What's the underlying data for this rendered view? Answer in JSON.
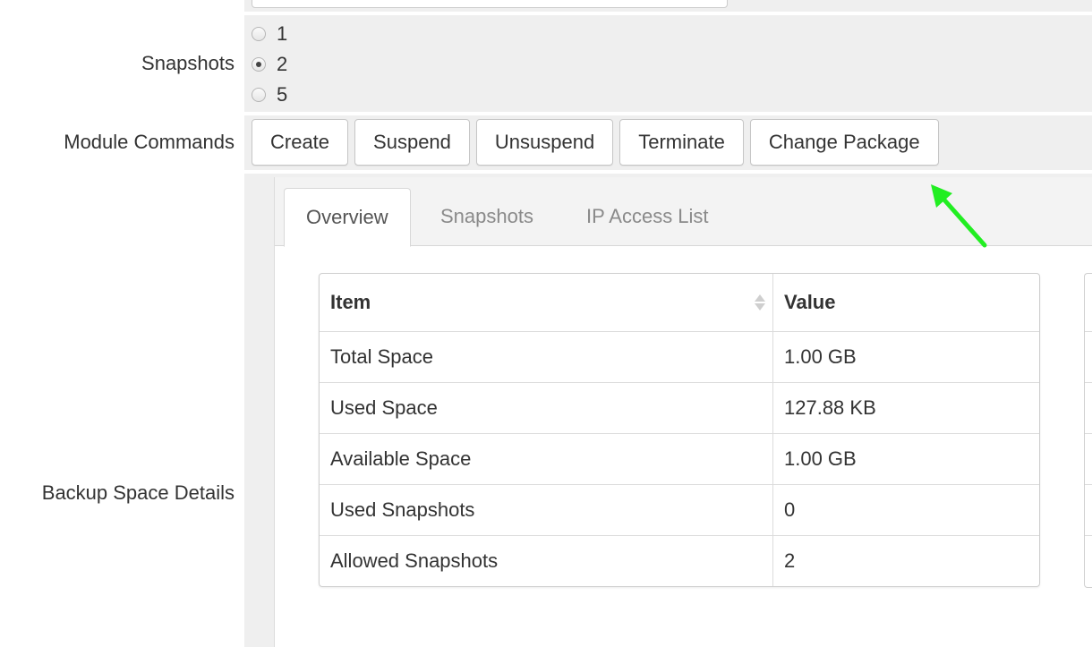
{
  "form": {
    "rows": {
      "snapshots_label": "Snapshots",
      "module_commands_label": "Module Commands",
      "backup_space_label": "Backup Space Details"
    },
    "snapshot_options": [
      {
        "label": "1",
        "selected": false
      },
      {
        "label": "2",
        "selected": true
      },
      {
        "label": "5",
        "selected": false
      }
    ],
    "commands": [
      "Create",
      "Suspend",
      "Unsuspend",
      "Terminate",
      "Change Package"
    ]
  },
  "panel": {
    "tabs": [
      {
        "label": "Overview",
        "active": true
      },
      {
        "label": "Snapshots",
        "active": false
      },
      {
        "label": "IP Access List",
        "active": false
      }
    ],
    "table": {
      "headers": [
        "Item",
        "Value"
      ],
      "rows": [
        [
          "Total Space",
          "1.00 GB"
        ],
        [
          "Used Space",
          "127.88 KB"
        ],
        [
          "Available Space",
          "1.00 GB"
        ],
        [
          "Used Snapshots",
          "0"
        ],
        [
          "Allowed Snapshots",
          "2"
        ]
      ]
    }
  },
  "colors": {
    "field_background": "#efefef",
    "annotation_arrow": "#22ee22"
  }
}
